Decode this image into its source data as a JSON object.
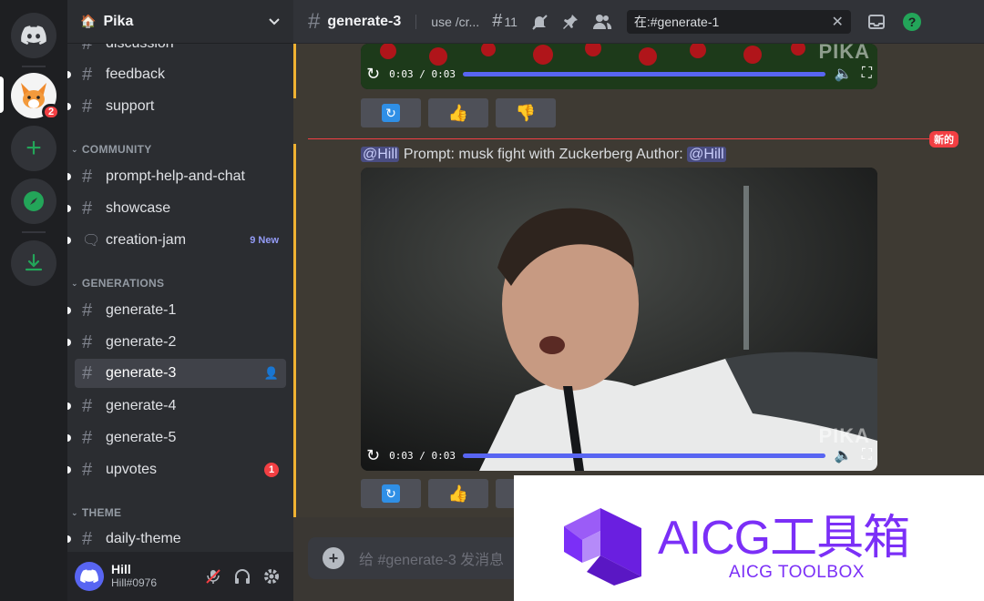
{
  "server": {
    "name": "Pika",
    "mention_badge": "2"
  },
  "sidebar": {
    "channels_top": [
      {
        "label": "discussion"
      },
      {
        "label": "feedback"
      },
      {
        "label": "support"
      }
    ],
    "categories": [
      {
        "label": "COMMUNITY",
        "items": [
          {
            "label": "prompt-help-and-chat"
          },
          {
            "label": "showcase"
          },
          {
            "label": "creation-jam",
            "tag": "9 New"
          }
        ]
      },
      {
        "label": "GENERATIONS",
        "items": [
          {
            "label": "generate-1"
          },
          {
            "label": "generate-2"
          },
          {
            "label": "generate-3"
          },
          {
            "label": "generate-4"
          },
          {
            "label": "generate-5"
          },
          {
            "label": "upvotes",
            "badge": "1"
          }
        ]
      },
      {
        "label": "THEME",
        "items": [
          {
            "label": "daily-theme"
          }
        ]
      }
    ]
  },
  "user": {
    "name": "Hill",
    "tag": "Hill#0976"
  },
  "topbar": {
    "channel": "generate-3",
    "topic": "use /cr...",
    "threads_count": "11",
    "search_value": "在:#generate-1"
  },
  "messages": {
    "video1_time": "0:03 / 0:03",
    "watermark": "PIKA",
    "new_label": "新的",
    "prompt_mention": "@Hill",
    "prompt_text": " Prompt: musk fight with Zuckerberg  Author: ",
    "author_mention": "@Hill",
    "video2_time": "0:03 / 0:03"
  },
  "composer": {
    "placeholder": "给 #generate-3 发消息"
  },
  "overlay": {
    "title": "AICG工具箱",
    "subtitle": "AICG TOOLBOX"
  },
  "colors": {
    "accent": "#5865f2",
    "brand_purple": "#7b2ff7",
    "highlight": "#f0b232",
    "danger": "#f23f43"
  }
}
